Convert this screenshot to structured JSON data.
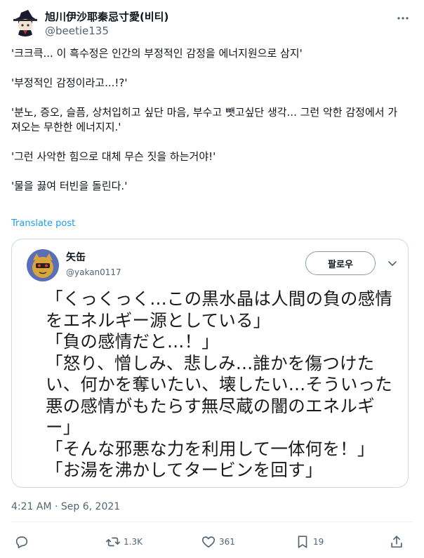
{
  "author": {
    "display_name": "旭川伊沙耶秦忌寸愛(비티)",
    "handle": "@beetie135",
    "avatar_icon": "witch-hat-avatar"
  },
  "tweet": {
    "lines": [
      "'크크큭... 이 흑수정은 인간의 부정적인 감정을 에너지원으로 삼지'",
      "'부정적인 감정이라고...!?'",
      "'분노, 증오, 슬픔, 상처입히고 싶단 마음, 부수고 뺏고싶단 생각... 그런 악한 감정에서 가져오는 무한한 에너지지.'",
      "'그런 사악한 힘으로 대체 무슨 짓을 하는거야!'",
      "'물을 끓여 터빈을 돌린다.'"
    ],
    "translate_label": "Translate post",
    "timestamp": "4:21 AM · Sep 6, 2021"
  },
  "quote": {
    "name": "矢缶",
    "handle": "@yakan0117",
    "follow_label": "팔로우",
    "lines": [
      "「くっくっく…この黒水晶は人間の負の感情",
      "をエネルギー源としている」",
      "「負の感情だと…！」",
      "「怒り、憎しみ、悲しみ…誰かを傷つけた",
      "い、何かを奪いたい、壊したい…そういった",
      "悪の感情がもたらす無尽蔵の闇のエネルギ",
      "ー」",
      "「そんな邪悪な力を利用して一体何を！」",
      "「お湯を沸かしてタービンを回す」"
    ]
  },
  "actions": {
    "reply_icon": "reply-icon",
    "retweet_count": "1.3K",
    "like_count": "361",
    "bookmark_count": "19",
    "share_icon": "share-icon"
  },
  "colors": {
    "link": "#1d9bf0",
    "secondary_text": "#536471",
    "border": "#cfd9de"
  }
}
